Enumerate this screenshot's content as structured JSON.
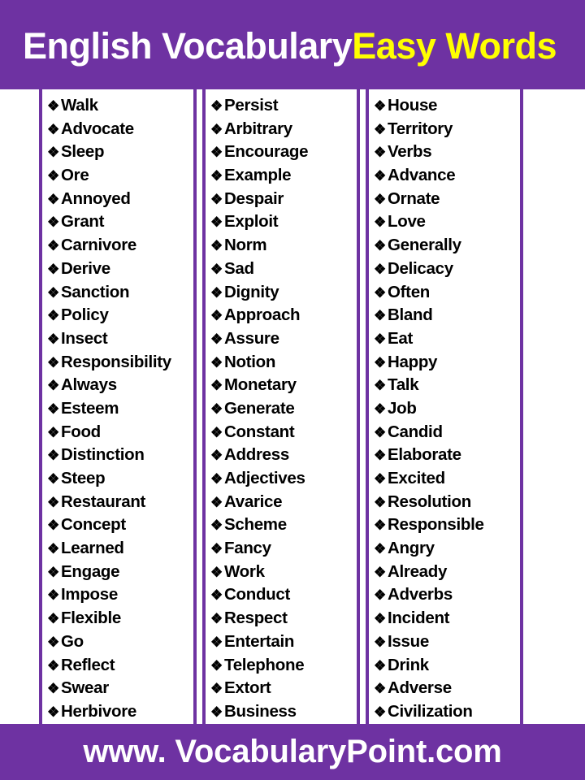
{
  "header": {
    "title_white": "English Vocabulary",
    "title_yellow": "Easy  Words",
    "background_color": "#6E32A2",
    "white_color": "#FFFFFF",
    "yellow_color": "#FFFF00"
  },
  "bullet_icon": "❖",
  "columns": [
    {
      "id": "column-1",
      "words": [
        "Walk",
        "Advocate",
        "Sleep",
        "Ore",
        "Annoyed",
        "Grant",
        "Carnivore",
        "Derive",
        "Sanction",
        "Policy",
        "Insect",
        "Responsibility",
        "Always",
        "Esteem",
        "Food",
        "Distinction",
        "Steep",
        "Restaurant",
        "Concept",
        "Learned",
        "Engage",
        "Impose",
        "Flexible",
        "Go",
        "Reflect",
        "Swear",
        "Herbivore"
      ]
    },
    {
      "id": "column-2",
      "words": [
        "Persist",
        "Arbitrary",
        "Encourage",
        "Example",
        "Despair",
        "Exploit",
        "Norm",
        "Sad",
        "Dignity",
        "Approach",
        "Assure",
        "Notion",
        "Monetary",
        "Generate",
        "Constant",
        "Address",
        "Adjectives",
        "Avarice",
        "Scheme",
        "Fancy",
        "Work",
        "Conduct",
        "Respect",
        "Entertain",
        "Telephone",
        "Extort",
        "Business"
      ]
    },
    {
      "id": "column-3",
      "words": [
        "House",
        "Territory",
        "Verbs",
        "Advance",
        "Ornate",
        "Love",
        "Generally",
        "Delicacy",
        "Often",
        "Bland",
        "Eat",
        "Happy",
        "Talk",
        "Job",
        "Candid",
        "Elaborate",
        "Excited",
        "Resolution",
        "Responsible",
        "Angry",
        "Already",
        "Adverbs",
        "Incident",
        "Issue",
        "Drink",
        "Adverse",
        "Civilization"
      ]
    }
  ],
  "footer": {
    "website": "www. VocabularyPoint.com",
    "background_color": "#6E32A2",
    "text_color": "#FFFFFF"
  }
}
